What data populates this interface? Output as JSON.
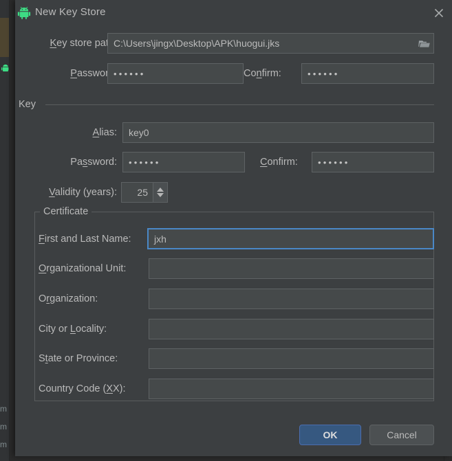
{
  "background": {
    "left_strip_marks": [
      "m",
      "m",
      "m"
    ],
    "android_icon": "android-icon"
  },
  "dialog": {
    "title": "New Key Store",
    "title_icon": "android-icon",
    "close_icon": "close-icon",
    "keystore": {
      "path_label": "Key store path:",
      "path_label_mnemonic": "K",
      "path_value": "C:\\Users\\jingx\\Desktop\\APK\\huogui.jks",
      "browse_icon": "folder-icon",
      "password_label": "Password:",
      "password_label_mnemonic": "P",
      "password_value": "••••••",
      "confirm_label": "Confirm:",
      "confirm_label_mnemonic": "n",
      "confirm_value": "••••••"
    },
    "key_group": {
      "title": "Key",
      "alias_label": "Alias:",
      "alias_label_mnemonic": "A",
      "alias_value": "key0",
      "password_label": "Password:",
      "password_label_mnemonic": "s",
      "password_value": "••••••",
      "confirm_label": "Confirm:",
      "confirm_label_mnemonic": "C",
      "confirm_value": "••••••",
      "validity_label": "Validity (years):",
      "validity_label_mnemonic": "V",
      "validity_value": "25"
    },
    "certificate": {
      "legend": "Certificate",
      "fields": [
        {
          "label": "First and Last Name:",
          "mnemonic": "F",
          "value": "jxh",
          "focused": true
        },
        {
          "label": "Organizational Unit:",
          "mnemonic": "O",
          "value": "",
          "focused": false
        },
        {
          "label": "Organization:",
          "mnemonic": "r",
          "value": "",
          "focused": false
        },
        {
          "label": "City or Locality:",
          "mnemonic": "L",
          "value": "",
          "focused": false
        },
        {
          "label": "State or Province:",
          "mnemonic": "t",
          "value": "",
          "focused": false
        },
        {
          "label": "Country Code (XX):",
          "mnemonic": "X",
          "value": "",
          "focused": false
        }
      ]
    },
    "buttons": {
      "ok": "OK",
      "cancel": "Cancel"
    }
  },
  "colors": {
    "dialog_bg": "#3c3f41",
    "field_bg": "#45494a",
    "field_border": "#5e6264",
    "focus_border": "#4a88c7",
    "text": "#bababa",
    "ok_bg": "#365880",
    "android_green": "#3ddc84"
  }
}
